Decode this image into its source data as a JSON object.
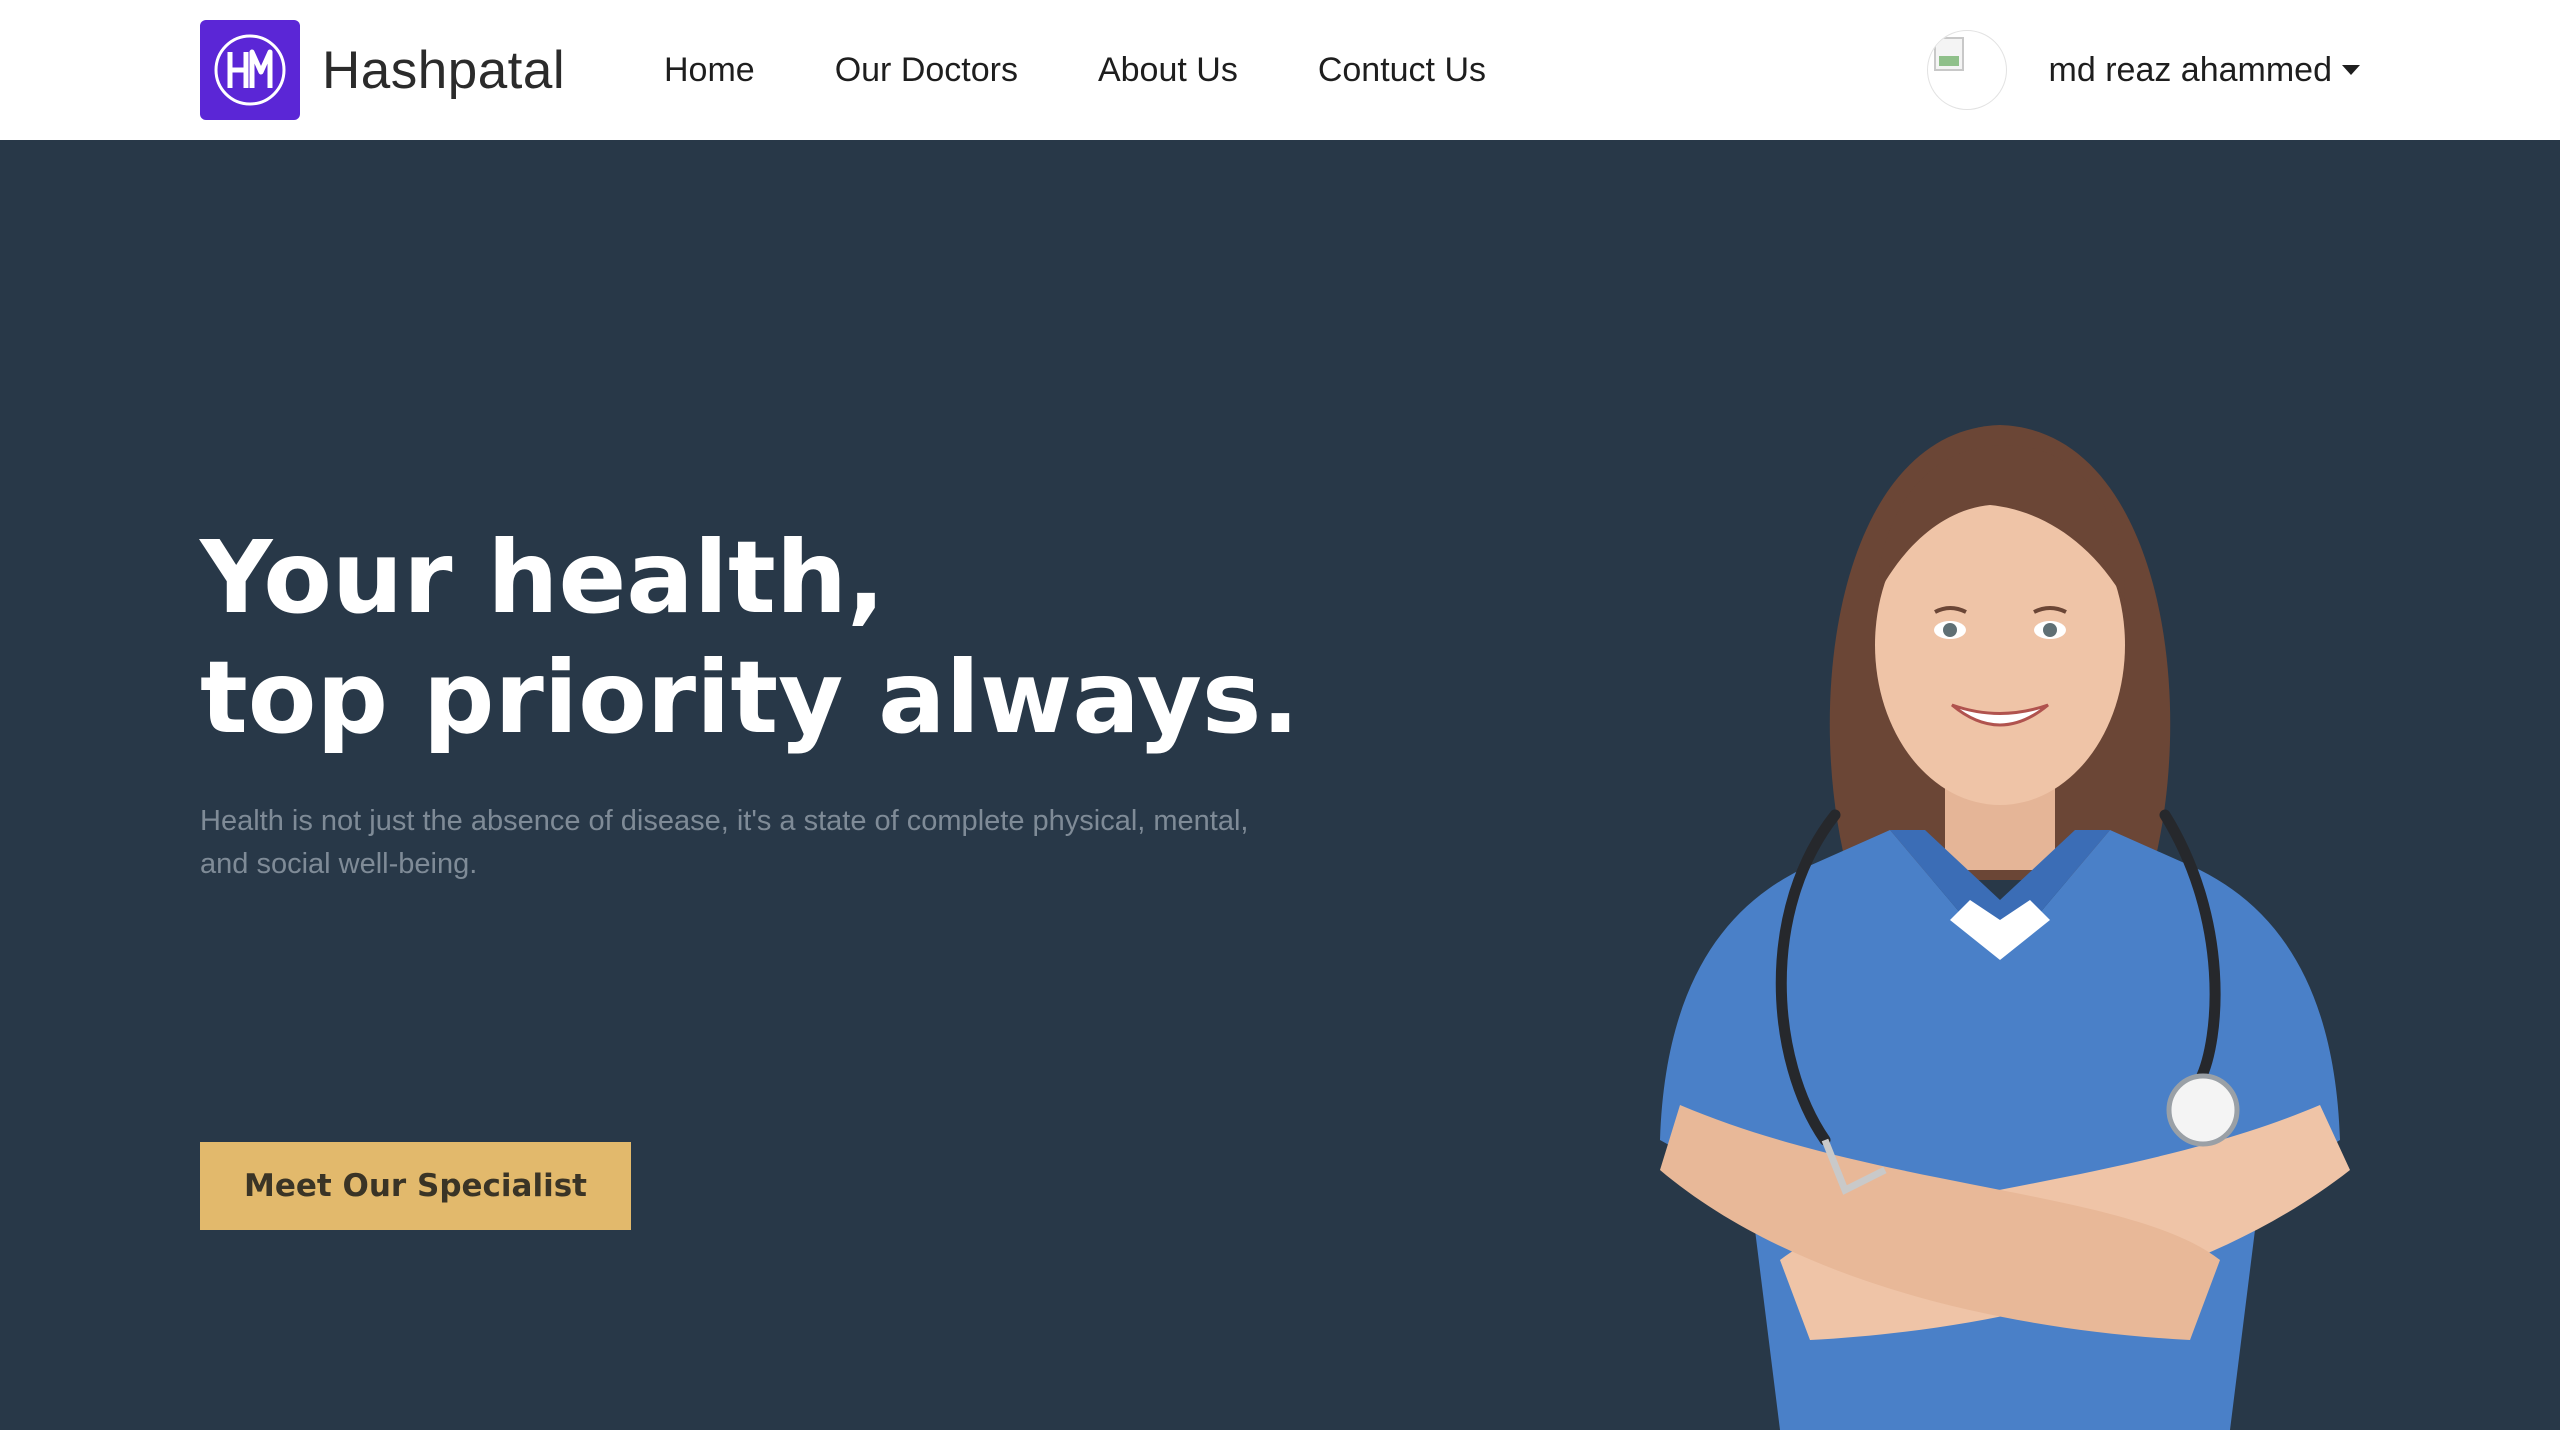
{
  "brand": {
    "name": "Hashpatal",
    "logo_icon": "hm-monogram-icon",
    "logo_color": "#5b26d6"
  },
  "nav": {
    "links": [
      {
        "label": "Home"
      },
      {
        "label": "Our Doctors"
      },
      {
        "label": "About Us"
      },
      {
        "label": "Contuct Us"
      }
    ]
  },
  "user": {
    "name": "md reaz ahammed",
    "avatar_icon": "broken-image-icon",
    "menu_icon": "caret-down-icon"
  },
  "hero": {
    "title_line1": "Your health,",
    "title_line2": "top priority always.",
    "subtitle": "Health is not just the absence of disease, it's a state of complete physical, mental, and social well-being.",
    "cta_label": "Meet Our Specialist",
    "image": "smiling-nurse-with-stethoscope"
  },
  "colors": {
    "hero_bg": "#283848",
    "cta_bg": "#e2b96c",
    "nav_bg": "#ffffff",
    "subtitle": "#7f8b97"
  }
}
